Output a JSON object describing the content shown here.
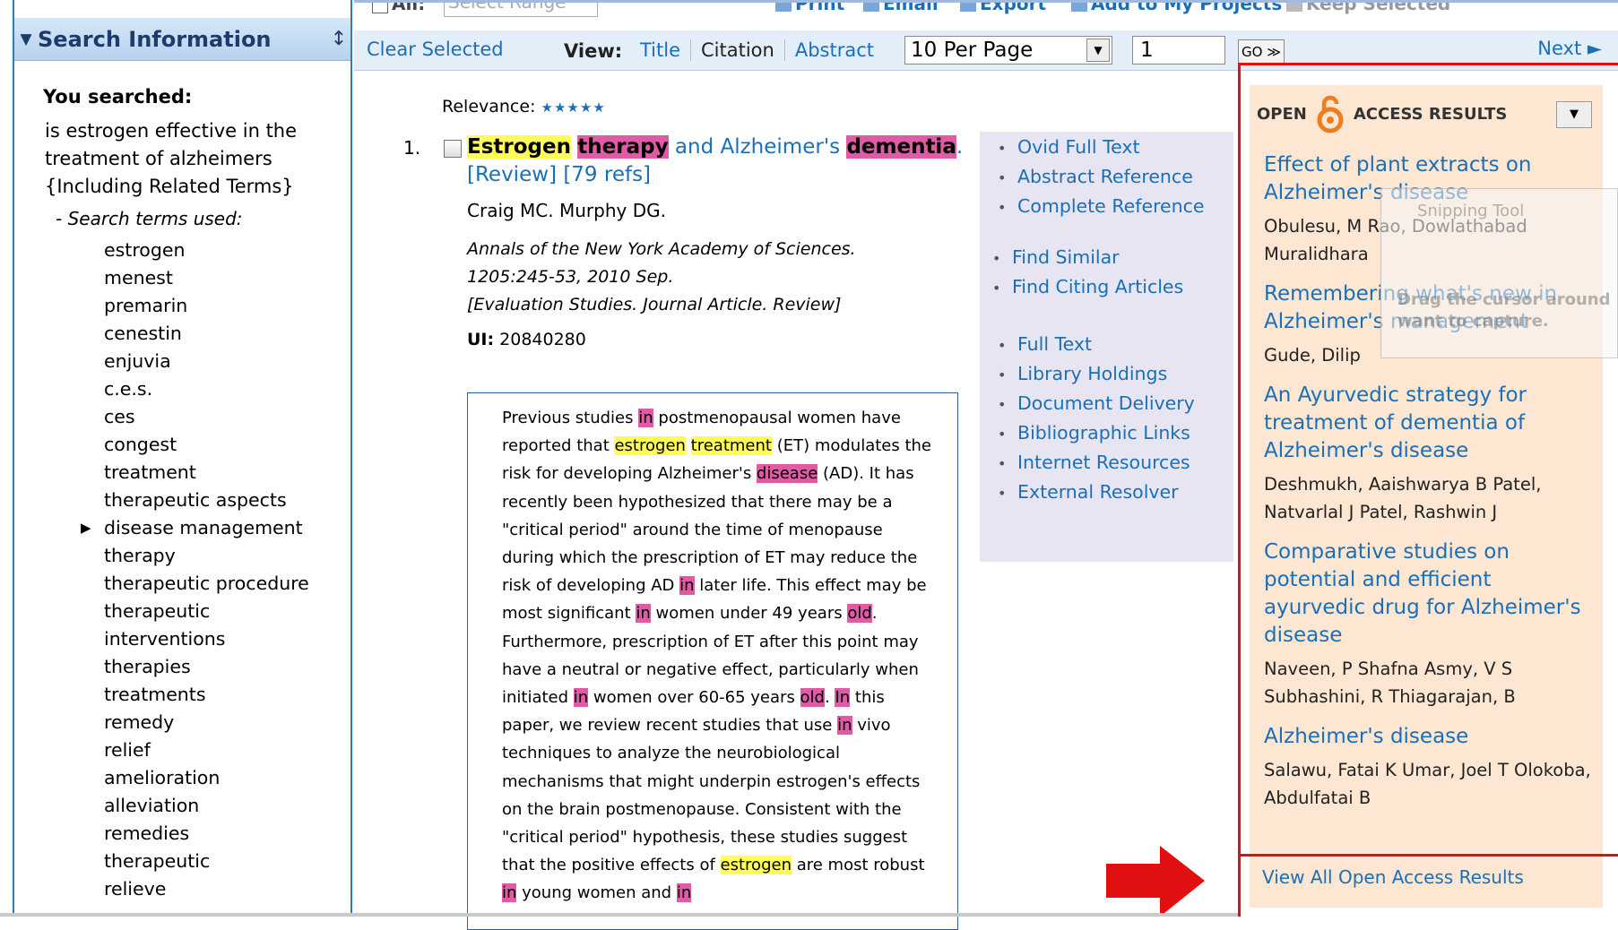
{
  "left_panel": {
    "title": "Search Information",
    "you_searched_label": "You searched:",
    "query": "is estrogen effective in the treatment of alzheimers {Including Related Terms}",
    "terms_label": "- Search terms used:",
    "terms": [
      "estrogen",
      "menest",
      "premarin",
      "cenestin",
      "enjuvia",
      "c.e.s.",
      "ces",
      "congest",
      "treatment",
      "therapeutic aspects",
      "disease management",
      "therapy",
      "therapeutic procedure",
      "therapeutic",
      "interventions",
      "therapies",
      "treatments",
      "remedy",
      "relief",
      "amelioration",
      "alleviation",
      "remedies",
      "therapeutic",
      "relieve"
    ]
  },
  "top_toolbar": {
    "all_label": "All:",
    "range_placeholder": "Select Range",
    "actions": [
      "Print",
      "Email",
      "Export",
      "Add to My Projects",
      "Keep Selected"
    ]
  },
  "sub_toolbar": {
    "clear_selected": "Clear Selected",
    "view_label": "View:",
    "views": [
      "Title",
      "Citation",
      "Abstract"
    ],
    "current_view": "Citation",
    "per_page": "10 Per Page",
    "page": "1",
    "go": "GO ≫",
    "next": "Next ►"
  },
  "result": {
    "relevance_label": "Relevance:",
    "relevance_stars": "★★★★★",
    "number": "1.",
    "title_parts": [
      {
        "text": "Estrogen",
        "hl": "y"
      },
      {
        "text": " ",
        "hl": ""
      },
      {
        "text": "therapy",
        "hl": "p"
      },
      {
        "text": " and Alzheimer's ",
        "hl": ""
      },
      {
        "text": "dementia",
        "hl": "p"
      },
      {
        "text": ". [Review] [79 refs]",
        "hl": ""
      }
    ],
    "authors": "Craig MC. Murphy DG.",
    "source_line1": "Annals of the New York Academy of Sciences.",
    "source_line2": "1205:245-53, 2010 Sep.",
    "source_line3": "[Evaluation Studies. Journal Article. Review]",
    "ui_label": "UI:",
    "ui_value": "20840280",
    "abstract": "Previous studies [[p:in]] postmenopausal women have reported that [[y:estrogen]] [[y:treatment]] (ET) modulates the risk for developing Alzheimer's [[p:disease]] (AD). It has recently been hypothesized that there may be a \"critical period\" around the time of menopause during which the prescription of ET may reduce the risk of developing AD [[p:in]] later life. This effect may be most significant [[p:in]] women under 49 years [[p:old]]. Furthermore, prescription of ET after this point may have a neutral or negative effect, particularly when initiated [[p:in]] women over 60-65 years [[p:old]]. [[p:In]] this paper, we review recent studies that use [[p:in]] vivo techniques to analyze the neurobiological mechanisms that might underpin estrogen's effects on the brain postmenopause. Consistent with the \"critical period\" hypothesis, these studies suggest that the positive effects of [[y:estrogen]] are most robust [[p:in]] young women and [[p:in]]"
  },
  "links": {
    "group1": [
      "Ovid Full Text",
      "Abstract Reference",
      "Complete Reference"
    ],
    "group2": [
      "Find Similar",
      "Find Citing Articles"
    ],
    "group3": [
      "Full Text",
      "Library Holdings",
      "Document Delivery",
      "Bibliographic Links",
      "Internet Resources",
      "External Resolver"
    ]
  },
  "open_access": {
    "header_left": "OPEN",
    "header_right": "ACCESS RESULTS",
    "items": [
      {
        "title": "Effect of plant extracts on Alzheimer's disease",
        "authors": "Obulesu, M Rao, Dowlathabad Muralidhara"
      },
      {
        "title": "Remembering what's new in Alzheimer's management",
        "authors": "Gude, Dilip"
      },
      {
        "title": "An Ayurvedic strategy for treatment of dementia of Alzheimer's disease",
        "authors": "Deshmukh, Aaishwarya B Patel, Natvarlal J Patel, Rashwin J"
      },
      {
        "title": "Comparative studies on potential and efficient ayurvedic drug for Alzheimer's disease",
        "authors": "Naveen, P Shafna Asmy, V S Subhashini, R Thiagarajan, B"
      },
      {
        "title": "Alzheimer's disease",
        "authors": "Salawu, Fatai K Umar, Joel T Olokoba, Abdulfatai B"
      }
    ],
    "view_all": "View All Open Access Results"
  },
  "snipping_overlay": {
    "title": "Snipping Tool",
    "hint": "Drag the cursor around want to capture."
  },
  "colors": {
    "link": "#1a6fb8",
    "highlight_yellow": "#ffff55",
    "highlight_pink": "#e05aa5",
    "oa_background": "#fde7d2",
    "callout_red": "#e01010"
  }
}
